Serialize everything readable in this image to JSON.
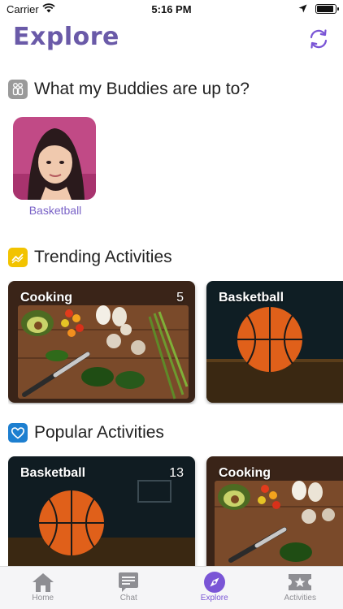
{
  "status": {
    "carrier": "Carrier",
    "time": "5:16 PM"
  },
  "header": {
    "title": "Explore"
  },
  "sections": {
    "buddies": {
      "title": "What my Buddies are up to?",
      "items": [
        {
          "label": "Basketball"
        }
      ]
    },
    "trending": {
      "title": "Trending Activities",
      "cards": [
        {
          "title": "Cooking",
          "count": "5"
        },
        {
          "title": "Basketball",
          "count": ""
        }
      ]
    },
    "popular": {
      "title": "Popular Activities",
      "cards": [
        {
          "title": "Basketball",
          "count": "13"
        },
        {
          "title": "Cooking",
          "count": ""
        }
      ]
    }
  },
  "tabs": [
    {
      "label": "Home",
      "icon": "home-icon"
    },
    {
      "label": "Chat",
      "icon": "chat-icon"
    },
    {
      "label": "Explore",
      "icon": "compass-icon",
      "active": true
    },
    {
      "label": "Activities",
      "icon": "star-ticket-icon"
    }
  ],
  "colors": {
    "accent": "#7a55d6",
    "title": "#6a5aa8",
    "trending_icon": "#f2c300",
    "popular_icon": "#1d7fd0"
  }
}
